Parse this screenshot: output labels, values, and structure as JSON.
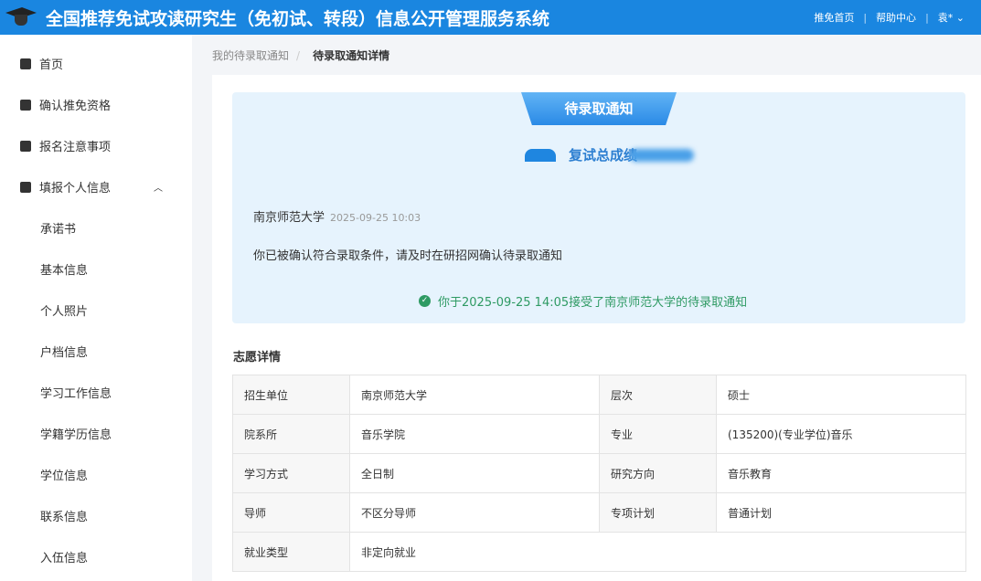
{
  "header": {
    "title": "全国推荐免试攻读研究生（免初试、转段）信息公开管理服务系统",
    "links": [
      "推免首页",
      "帮助中心",
      "袁*"
    ]
  },
  "sidebar": {
    "items": [
      {
        "label": "首页",
        "icon": "home-icon",
        "sub": false
      },
      {
        "label": "确认推免资格",
        "icon": "shield-icon",
        "sub": false
      },
      {
        "label": "报名注意事项",
        "icon": "list-icon",
        "sub": false
      },
      {
        "label": "填报个人信息",
        "icon": "form-icon",
        "sub": false
      },
      {
        "label": "承诺书",
        "sub": true
      },
      {
        "label": "基本信息",
        "sub": true
      },
      {
        "label": "个人照片",
        "sub": true
      },
      {
        "label": "户档信息",
        "sub": true
      },
      {
        "label": "学习工作信息",
        "sub": true
      },
      {
        "label": "学籍学历信息",
        "sub": true
      },
      {
        "label": "学位信息",
        "sub": true
      },
      {
        "label": "联系信息",
        "sub": true
      },
      {
        "label": "入伍信息",
        "sub": true
      }
    ]
  },
  "breadcrumb": {
    "parent": "我的待录取通知",
    "current": "待录取通知详情"
  },
  "notice": {
    "ribbon": "待录取通知",
    "score_label": "复试总成绩",
    "university": "南京师范大学",
    "time": "2025-09-25 10:03",
    "message": "你已被确认符合录取条件，请及时在研招网确认待录取通知",
    "accepted": "你于2025-09-25 14:05接受了南京师范大学的待录取通知"
  },
  "details": {
    "title": "志愿详情",
    "rows": [
      [
        "招生单位",
        "南京师范大学",
        "层次",
        "硕士"
      ],
      [
        "院系所",
        "音乐学院",
        "专业",
        "(135200)(专业学位)音乐"
      ],
      [
        "学习方式",
        "全日制",
        "研究方向",
        "音乐教育"
      ],
      [
        "导师",
        "不区分导师",
        "专项计划",
        "普通计划"
      ],
      [
        "就业类型",
        "非定向就业",
        "",
        ""
      ]
    ]
  }
}
